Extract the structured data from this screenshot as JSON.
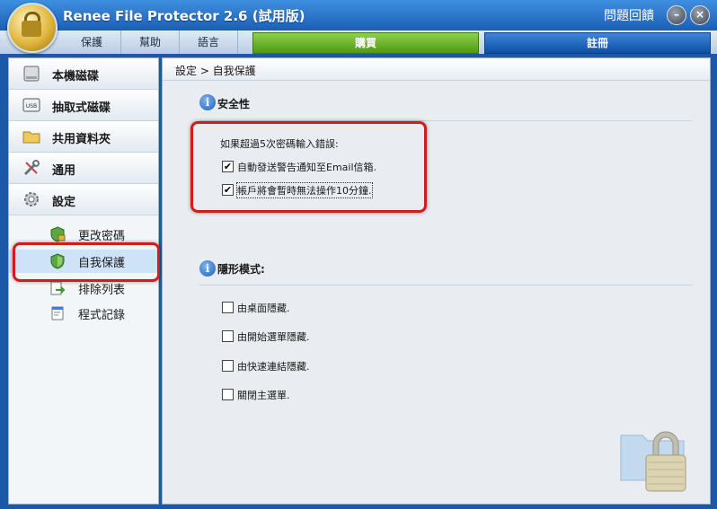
{
  "window": {
    "title": "Renee File Protector 2.6 (試用版)",
    "feedback": "問題回饋",
    "minimize_glyph": "–",
    "close_glyph": "×"
  },
  "menu": {
    "items": [
      "保護",
      "幫助",
      "語言"
    ],
    "buy": "購買",
    "register": "註冊"
  },
  "sidebar": {
    "items": [
      {
        "label": "本機磁碟",
        "icon": "hard-disk-icon"
      },
      {
        "label": "抽取式磁碟",
        "icon": "usb-drive-icon"
      },
      {
        "label": "共用資料夾",
        "icon": "shared-folder-icon"
      },
      {
        "label": "通用",
        "icon": "tools-icon"
      },
      {
        "label": "設定",
        "icon": "gear-icon"
      }
    ],
    "sub_items": [
      {
        "label": "更改密碼",
        "icon": "shield-lock-icon"
      },
      {
        "label": "自我保護",
        "icon": "shield-icon",
        "selected": true
      },
      {
        "label": "排除列表",
        "icon": "exclude-arrow-icon"
      },
      {
        "label": "程式記錄",
        "icon": "log-icon"
      }
    ]
  },
  "content": {
    "breadcrumb": "設定 > 自我保護",
    "security": {
      "title": "安全性",
      "prompt": "如果超過5次密碼輸入錯誤:",
      "options": [
        {
          "label": "自動發送警告通知至Email信箱.",
          "checked": true
        },
        {
          "label": "帳戶將會暫時無法操作10分鐘.",
          "checked": true
        }
      ]
    },
    "stealth": {
      "title": "隱形模式:",
      "options": [
        {
          "label": "由桌面隱藏.",
          "checked": false
        },
        {
          "label": "由開始選單隱藏.",
          "checked": false
        },
        {
          "label": "由快速連結隱藏.",
          "checked": false
        },
        {
          "label": "關閉主選單.",
          "checked": false
        }
      ]
    },
    "info_glyph": "i",
    "check_glyph": "✔"
  },
  "colors": {
    "titlebar": "#1b5fb5",
    "buy": "#4e9a12",
    "register": "#0e4fa3",
    "highlight": "#d11c1c"
  }
}
